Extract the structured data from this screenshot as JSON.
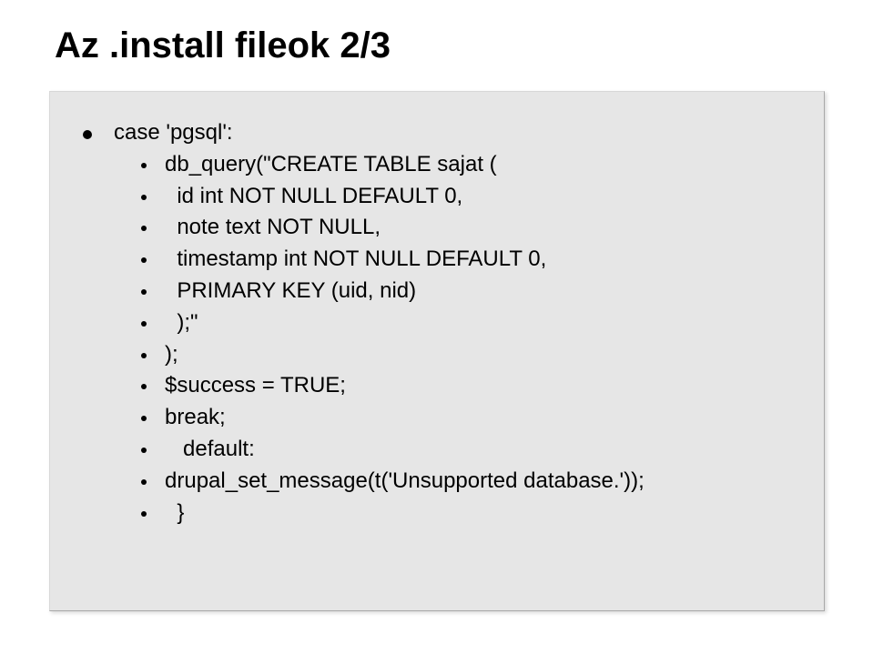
{
  "title": "Az .install fileok 2/3",
  "code": {
    "line0": "case 'pgsql':",
    "line1": "db_query(\"CREATE TABLE sajat (",
    "line2": "  id int NOT NULL DEFAULT 0,",
    "line3": "  note text NOT NULL,",
    "line4": "  timestamp int NOT NULL DEFAULT 0,",
    "line5": "  PRIMARY KEY (uid, nid)",
    "line6": "  );\"",
    "line7": ");",
    "line8": "$success = TRUE;",
    "line9": "break;",
    "line10": "   default:",
    "line11": "drupal_set_message(t('Unsupported database.'));",
    "line12": "  }"
  }
}
